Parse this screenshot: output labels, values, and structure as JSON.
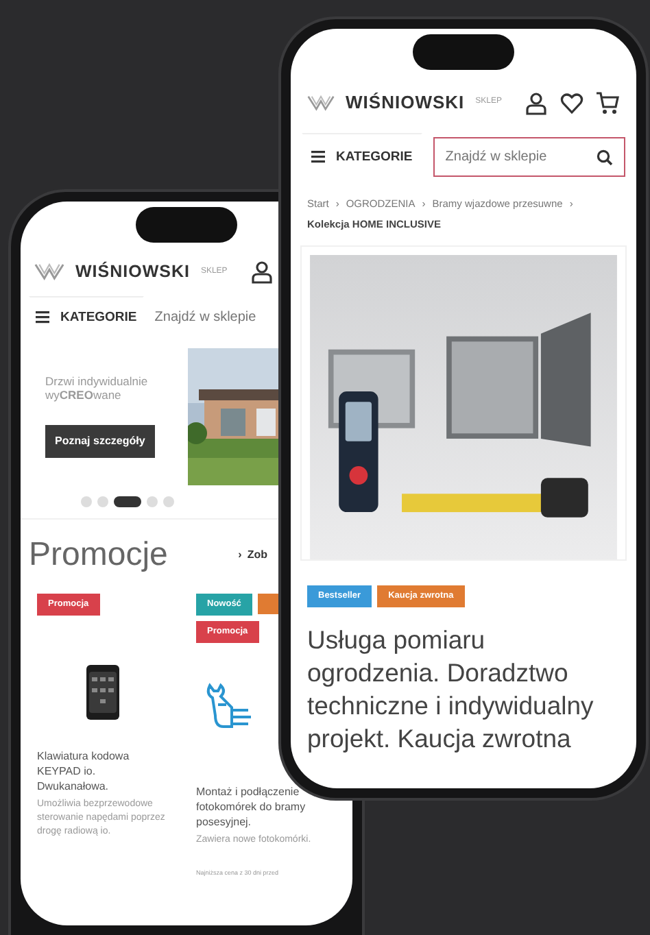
{
  "back_phone": {
    "brand": "WIŚNIOWSKI",
    "brand_tag": "SKLEP",
    "menu_label": "KATEGORIE",
    "search": {
      "placeholder": "Znajdź w sklepie"
    },
    "banner": {
      "text": "Drzwi indywidualnie wy**CREO**wane",
      "button": "Poznaj szczegóły"
    },
    "carousel_dots": [
      {
        "selected": false
      },
      {
        "selected": false
      },
      {
        "selected": true
      },
      {
        "selected": false
      },
      {
        "selected": false
      }
    ],
    "section": {
      "title": "Promocje",
      "link_icon": "›",
      "link": "Zob"
    },
    "products": [
      {
        "badges": [
          {
            "label": "Promocja",
            "color": "#d8414b"
          }
        ],
        "name": "Klawiatura kodowa KEYPAD io. Dwukanałowa.",
        "description": "Umożliwia bezprzewodowe sterowanie napędami poprzez drogę radiową io."
      },
      {
        "kind": "icon",
        "badges": [
          {
            "label": "Nowość",
            "color": "#27a3a6"
          },
          {
            "color": "#e07b32"
          },
          {
            "label": "Promocja",
            "color": "#d8414b"
          }
        ],
        "name": "Montaż i podłączenie fotokomórek do bramy posesyjnej.",
        "description": "Zawiera nowe fotokomórki.",
        "note": "Najniższa cena z 30 dni przed"
      }
    ]
  },
  "front_phone": {
    "brand": "WIŚNIOWSKI",
    "brand_tag": "SKLEP",
    "menu_label": "KATEGORIE",
    "search": {
      "placeholder": "Znajdź w sklepie",
      "focused": true
    },
    "breadcrumb": {
      "separator": "›",
      "items": [
        "Start",
        "OGRODZENIA",
        "Bramy wjazdowe przesuwne"
      ],
      "current": "Kolekcja HOME INCLUSIVE"
    },
    "badges": [
      {
        "label": "Bestseller",
        "color": "#3a9ad9"
      },
      {
        "label": "Kaucja zwrotna",
        "color": "#e07b32"
      }
    ],
    "title": "Usługa pomiaru ogrodzenia. Doradztwo techniczne i indywidualny projekt. Kaucja zwrotna"
  }
}
